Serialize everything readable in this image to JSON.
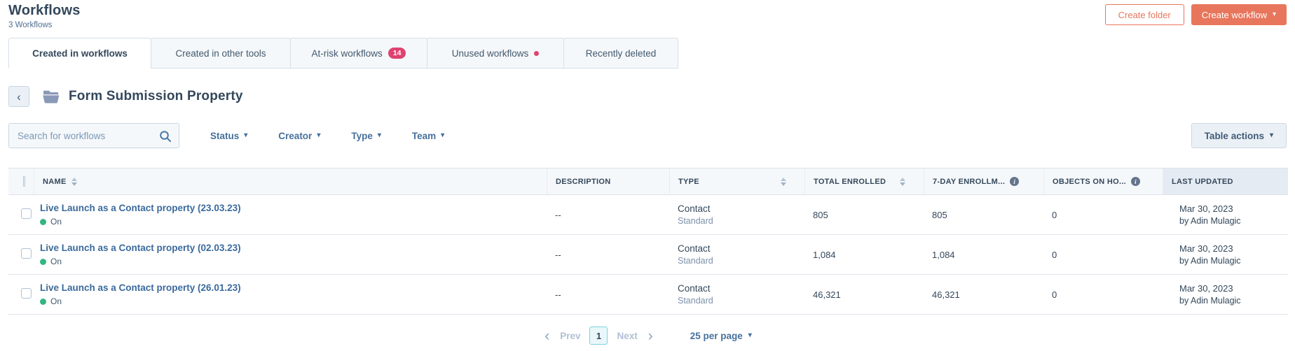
{
  "page": {
    "title": "Workflows",
    "subtitle": "3 Workflows"
  },
  "actions": {
    "create_folder": "Create folder",
    "create_workflow": "Create workflow"
  },
  "tabs": [
    {
      "label": "Created in workflows",
      "active": true
    },
    {
      "label": "Created in other tools"
    },
    {
      "label": "At-risk workflows",
      "badge": "14"
    },
    {
      "label": "Unused workflows",
      "dot": true
    },
    {
      "label": "Recently deleted"
    }
  ],
  "folder": {
    "name": "Form Submission Property"
  },
  "filters": {
    "search_placeholder": "Search for workflows",
    "status": "Status",
    "creator": "Creator",
    "type": "Type",
    "team": "Team",
    "table_actions": "Table actions"
  },
  "table": {
    "headers": {
      "name": "NAME",
      "description": "DESCRIPTION",
      "type": "TYPE",
      "total_enrolled": "TOTAL ENROLLED",
      "seven_day": "7-DAY ENROLLM...",
      "objects": "OBJECTS ON HO...",
      "last_updated": "LAST UPDATED"
    },
    "rows": [
      {
        "name": "Live Launch as a Contact property (23.03.23)",
        "status": "On",
        "description": "--",
        "type": "Contact",
        "type_sub": "Standard",
        "total_enrolled": "805",
        "seven_day": "805",
        "objects": "0",
        "updated_date": "Mar 30, 2023",
        "updated_by": "by Adin Mulagic"
      },
      {
        "name": "Live Launch as a Contact property (02.03.23)",
        "status": "On",
        "description": "--",
        "type": "Contact",
        "type_sub": "Standard",
        "total_enrolled": "1,084",
        "seven_day": "1,084",
        "objects": "0",
        "updated_date": "Mar 30, 2023",
        "updated_by": "by Adin Mulagic"
      },
      {
        "name": "Live Launch as a Contact property (26.01.23)",
        "status": "On",
        "description": "--",
        "type": "Contact",
        "type_sub": "Standard",
        "total_enrolled": "46,321",
        "seven_day": "46,321",
        "objects": "0",
        "updated_date": "Mar 30, 2023",
        "updated_by": "by Adin Mulagic"
      }
    ]
  },
  "pagination": {
    "prev": "Prev",
    "page": "1",
    "next": "Next",
    "per_page": "25 per page"
  },
  "colors": {
    "accent-orange": "#e8765c",
    "badge-pink": "#e0426f",
    "status-green": "#32b781",
    "link-blue": "#3a6a9d",
    "heading-navy": "#33475b",
    "steel-blue": "#46709c"
  }
}
